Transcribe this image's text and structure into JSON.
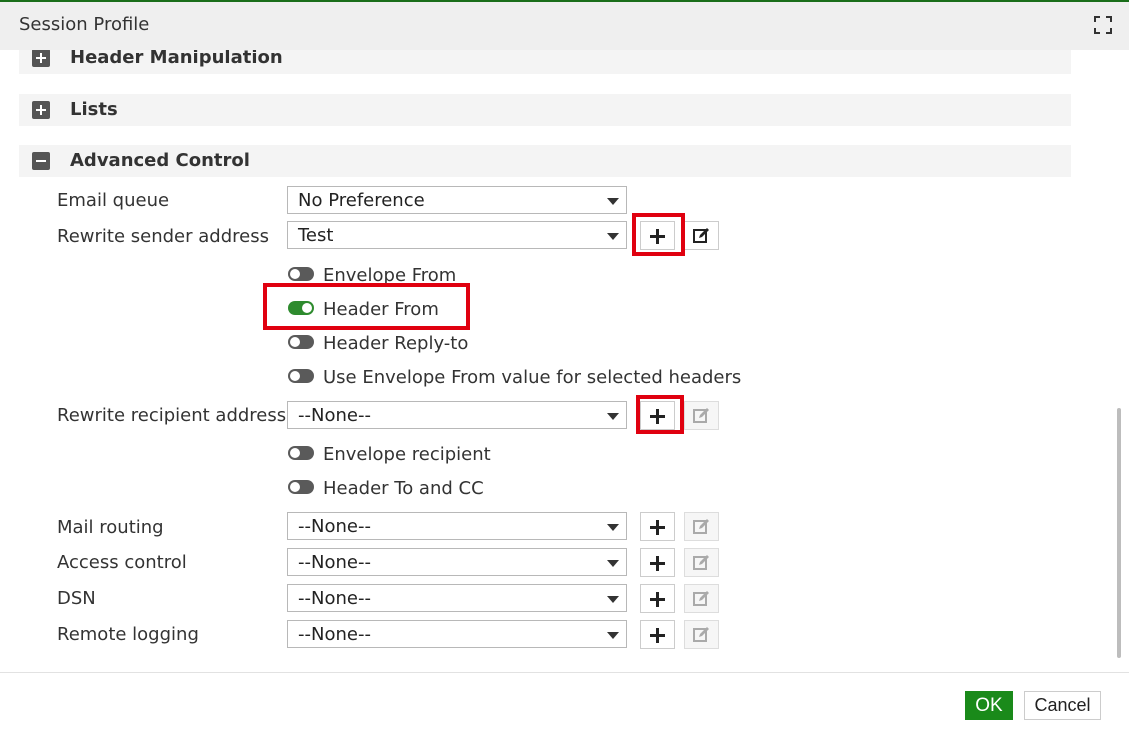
{
  "dialog": {
    "title": "Session Profile",
    "maximize_icon": "maximize-icon"
  },
  "sections": {
    "header_manipulation": {
      "label": "Header Manipulation",
      "state": "collapsed"
    },
    "lists": {
      "label": "Lists",
      "state": "collapsed"
    },
    "advanced_control": {
      "label": "Advanced Control",
      "state": "expanded"
    }
  },
  "fields": {
    "email_queue": {
      "label": "Email queue",
      "value": "No Preference"
    },
    "rewrite_sender": {
      "label": "Rewrite sender address",
      "value": "Test"
    },
    "rewrite_recipient": {
      "label": "Rewrite recipient address",
      "value": "--None--"
    },
    "mail_routing": {
      "label": "Mail routing",
      "value": "--None--"
    },
    "access_control": {
      "label": "Access control",
      "value": "--None--"
    },
    "dsn": {
      "label": "DSN",
      "value": "--None--"
    },
    "remote_logging": {
      "label": "Remote logging",
      "value": "--None--"
    }
  },
  "toggles": {
    "envelope_from": {
      "label": "Envelope From",
      "on": false
    },
    "header_from": {
      "label": "Header From",
      "on": true
    },
    "header_reply_to": {
      "label": "Header Reply-to",
      "on": false
    },
    "use_envelope_from": {
      "label": "Use Envelope From value for selected headers",
      "on": false
    },
    "envelope_recipient": {
      "label": "Envelope recipient",
      "on": false
    },
    "header_to_cc": {
      "label": "Header To and CC",
      "on": false
    }
  },
  "footer": {
    "ok_label": "OK",
    "cancel_label": "Cancel"
  },
  "colors": {
    "accent": "#1a8a1a",
    "toggle_on": "#2e8b2e",
    "highlight": "#e0000f"
  }
}
